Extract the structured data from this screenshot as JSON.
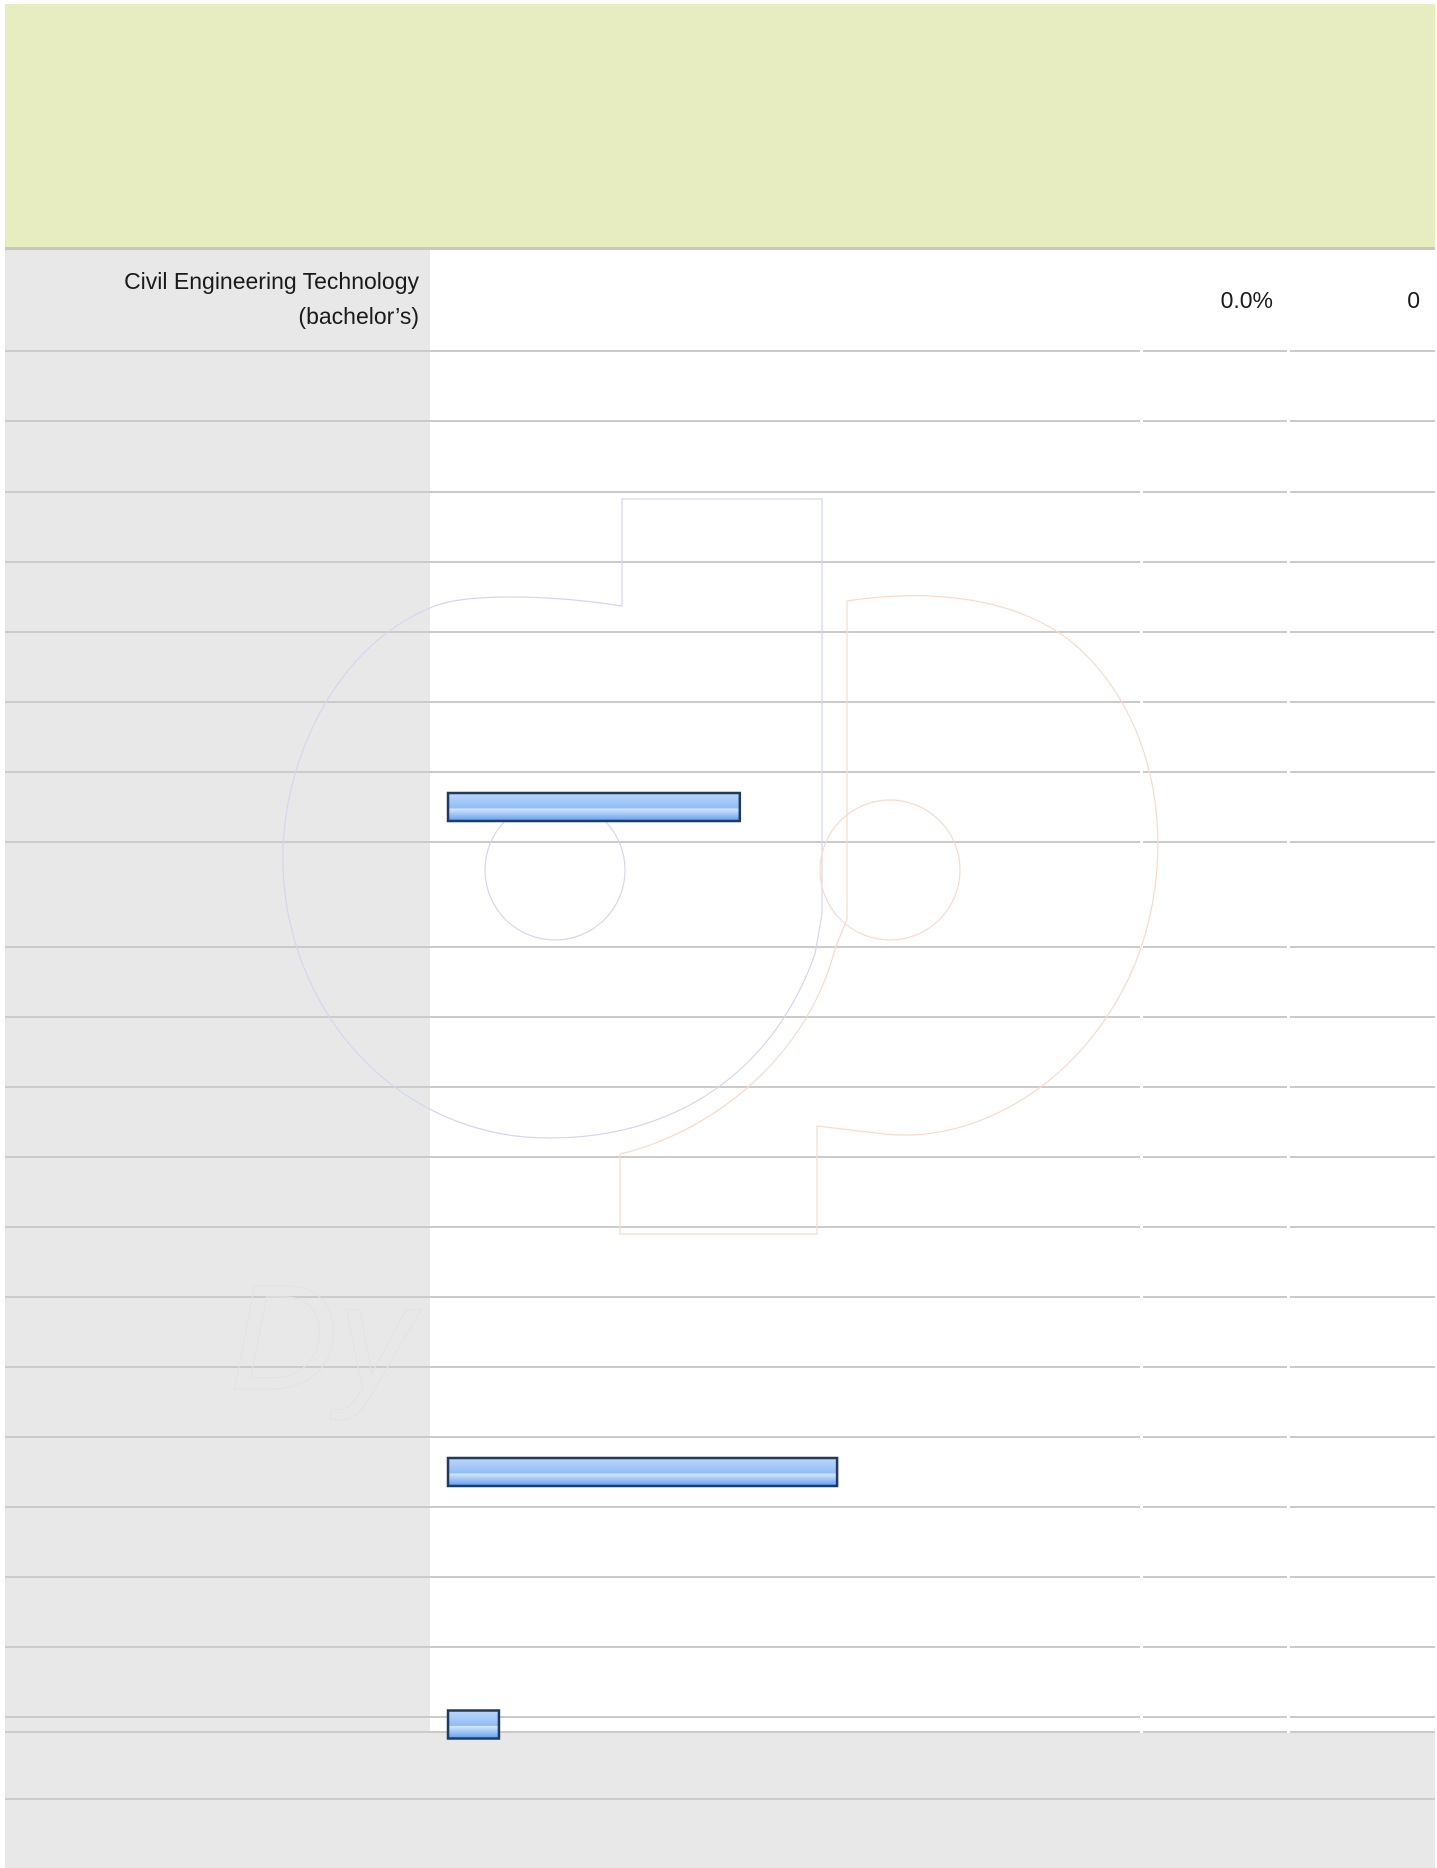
{
  "chart_data": {
    "type": "bar",
    "orientation": "horizontal",
    "rows": [
      {
        "label": "Civil Engineering Technology (bachelor’s)",
        "percent": "0.0%",
        "count": "0",
        "value": 0
      },
      {
        "label": "",
        "value": 0
      },
      {
        "label": "",
        "value": 0
      },
      {
        "label": "",
        "value": 0
      },
      {
        "label": "",
        "value": 0
      },
      {
        "label": "",
        "value": 0
      },
      {
        "label": "",
        "value": 0
      },
      {
        "label": "",
        "value": 0.378
      },
      {
        "label": "",
        "value": 0
      },
      {
        "label": "",
        "value": 0
      },
      {
        "label": "",
        "value": 0
      },
      {
        "label": "",
        "value": 0
      },
      {
        "label": "",
        "value": 0
      },
      {
        "label": "",
        "value": 0
      },
      {
        "label": "",
        "value": 0
      },
      {
        "label": "",
        "value": 0
      },
      {
        "label": "",
        "value": 0.504
      },
      {
        "label": "",
        "value": 0
      },
      {
        "label": "",
        "value": 0
      },
      {
        "label": "",
        "value": 0
      },
      {
        "label": "",
        "value": 0.066
      }
    ],
    "bar_fill_top": "#bcd7fb",
    "bar_fill_bottom": "#5e9ef0",
    "bar_stroke": "#1f3b5e",
    "label_column_color": "#e8e8e8",
    "header_color": "#e7edc1",
    "gridlines": true,
    "watermark_text": "Dy",
    "watermark": true
  }
}
